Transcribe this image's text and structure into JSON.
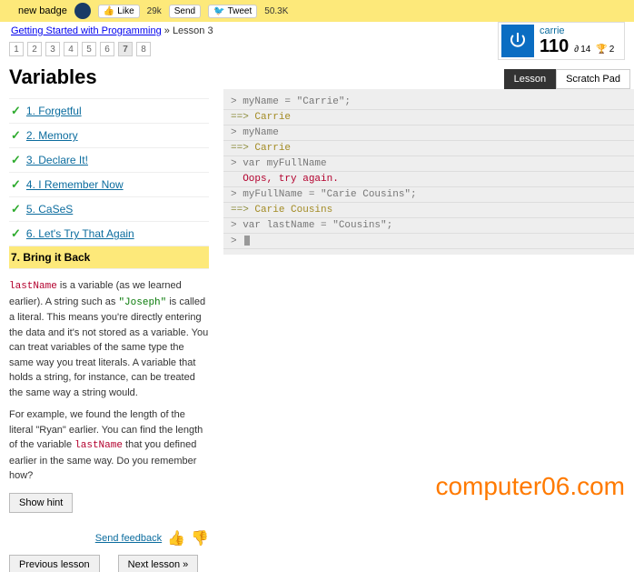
{
  "topbar": {
    "badge_text": "new badge",
    "like_label": "Like",
    "like_count": "29k",
    "send_label": "Send",
    "tweet_label": "Tweet",
    "tweet_count": "50.3K"
  },
  "breadcrumb": {
    "course": "Getting Started with Programming",
    "sep": "»",
    "lesson": "Lesson 3"
  },
  "pager": [
    "1",
    "2",
    "3",
    "4",
    "5",
    "6",
    "7",
    "8"
  ],
  "pager_active": 6,
  "user": {
    "name": "carrie",
    "points": "110",
    "streak": "14",
    "trophies": "2"
  },
  "left": {
    "title": "Variables",
    "items": [
      {
        "n": "1.",
        "label": "Forgetful",
        "done": true
      },
      {
        "n": "2.",
        "label": "Memory",
        "done": true
      },
      {
        "n": "3.",
        "label": "Declare It!",
        "done": true
      },
      {
        "n": "4.",
        "label": "I Remember Now",
        "done": true
      },
      {
        "n": "5.",
        "label": "CaSeS",
        "done": true
      },
      {
        "n": "6.",
        "label": "Let's Try That Again",
        "done": true
      },
      {
        "n": "7.",
        "label": "Bring it Back",
        "done": false,
        "current": true
      }
    ],
    "p1a": "lastName",
    "p1b": " is a variable (as we learned earlier). A string such as ",
    "p1c": "\"Joseph\"",
    "p1d": " is called a literal. This means you're directly entering the data and it's not stored as a variable. You can treat variables of the same type the same way you treat literals. A variable that holds a string, for instance, can be treated the same way a string would.",
    "p2a": "For example, we found the length of the literal \"Ryan\" earlier. You can find the length of the variable ",
    "p2b": "lastName",
    "p2c": " that you defined earlier in the same way. Do you remember how?",
    "show_hint": "Show hint",
    "send_feedback": "Send feedback",
    "prev": "Previous lesson",
    "next": "Next lesson »"
  },
  "tabs": {
    "lesson": "Lesson",
    "scratch": "Scratch Pad"
  },
  "console": [
    {
      "t": "in",
      "text": "myName = \"Carrie\";"
    },
    {
      "t": "out",
      "text": "Carrie"
    },
    {
      "t": "in",
      "text": "myName"
    },
    {
      "t": "out",
      "text": "Carrie"
    },
    {
      "t": "in",
      "text": "var myFullName"
    },
    {
      "t": "err",
      "text": "Oops, try again."
    },
    {
      "t": "in",
      "text": "myFullName = \"Carie Cousins\";"
    },
    {
      "t": "out",
      "text": "Carie Cousins"
    },
    {
      "t": "in",
      "text": "var lastName = \"Cousins\";"
    },
    {
      "t": "cursor",
      "text": ""
    }
  ],
  "watermark": "computer06.com"
}
